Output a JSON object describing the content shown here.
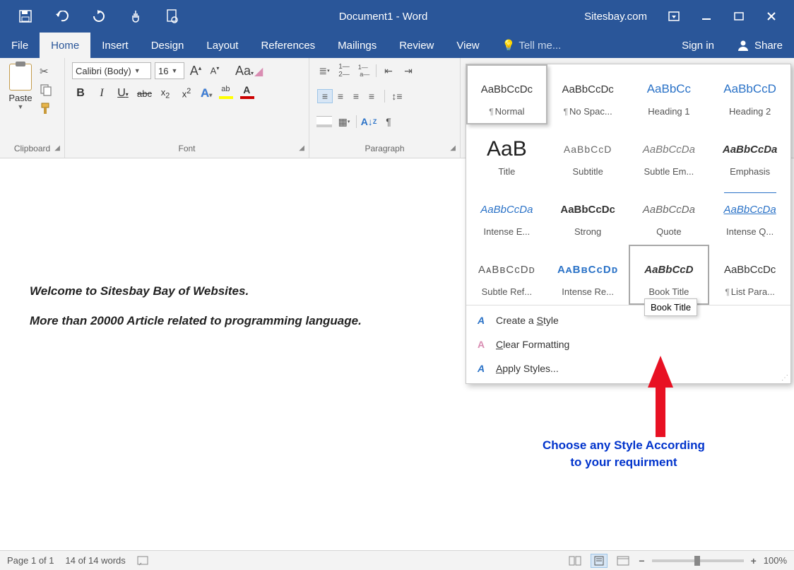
{
  "titleBar": {
    "title": "Document1 - Word",
    "site": "Sitesbay.com"
  },
  "menu": {
    "file": "File",
    "home": "Home",
    "insert": "Insert",
    "design": "Design",
    "layout": "Layout",
    "references": "References",
    "mailings": "Mailings",
    "review": "Review",
    "view": "View",
    "tellMe": "Tell me...",
    "signIn": "Sign in",
    "share": "Share"
  },
  "ribbon": {
    "clipboard": {
      "label": "Clipboard",
      "paste": "Paste"
    },
    "font": {
      "label": "Font",
      "name": "Calibri (Body)",
      "size": "16"
    },
    "paragraph": {
      "label": "Paragraph"
    }
  },
  "document": {
    "line1": "Welcome to Sitesbay Bay of Websites.",
    "line2": "More than 20000 Article related to programming language."
  },
  "styles": {
    "items": [
      {
        "preview": "AaBbCcDc",
        "label": "Normal",
        "cls": "",
        "selected": true,
        "pilcrow": true
      },
      {
        "preview": "AaBbCcDc",
        "label": "No Spac...",
        "cls": "",
        "pilcrow": true
      },
      {
        "preview": "AaBbCc",
        "label": "Heading 1",
        "cls": "sp-heading"
      },
      {
        "preview": "AaBbCcD",
        "label": "Heading 2",
        "cls": "sp-heading"
      },
      {
        "preview": "AaB",
        "label": "Title",
        "cls": "sp-title"
      },
      {
        "preview": "AaBbCcD",
        "label": "Subtitle",
        "cls": "sp-subtitle"
      },
      {
        "preview": "AaBbCcDa",
        "label": "Subtle Em...",
        "cls": "sp-subtleem"
      },
      {
        "preview": "AaBbCcDa",
        "label": "Emphasis",
        "cls": "sp-emphasis"
      },
      {
        "preview": "AaBbCcDa",
        "label": "Intense E...",
        "cls": "sp-intensee"
      },
      {
        "preview": "AaBbCcDc",
        "label": "Strong",
        "cls": "sp-strong"
      },
      {
        "preview": "AaBbCcDa",
        "label": "Quote",
        "cls": "sp-quote"
      },
      {
        "preview": "AaBbCcDa",
        "label": "Intense Q...",
        "cls": "sp-intenseq"
      },
      {
        "preview": "AᴀBʙCᴄDᴅ",
        "label": "Subtle Ref...",
        "cls": "sp-subtleref"
      },
      {
        "preview": "AᴀBʙCᴄDᴅ",
        "label": "Intense Re...",
        "cls": "sp-intenseref"
      },
      {
        "preview": "AaBbCcD",
        "label": "Book Title",
        "cls": "sp-booktitle",
        "highlighted": true
      },
      {
        "preview": "AaBbCcDc",
        "label": "List Para...",
        "cls": "sp-listpara",
        "pilcrow": true
      }
    ],
    "createStyle": "Create a Style",
    "clearFormat": "Clear Formatting",
    "applyStyles": "Apply Styles..."
  },
  "tooltip": "Book Title",
  "annotation": {
    "line1": "Choose any Style According",
    "line2": "to your requirment"
  },
  "statusBar": {
    "page": "Page 1 of 1",
    "words": "14 of 14 words",
    "zoom": "100%"
  }
}
